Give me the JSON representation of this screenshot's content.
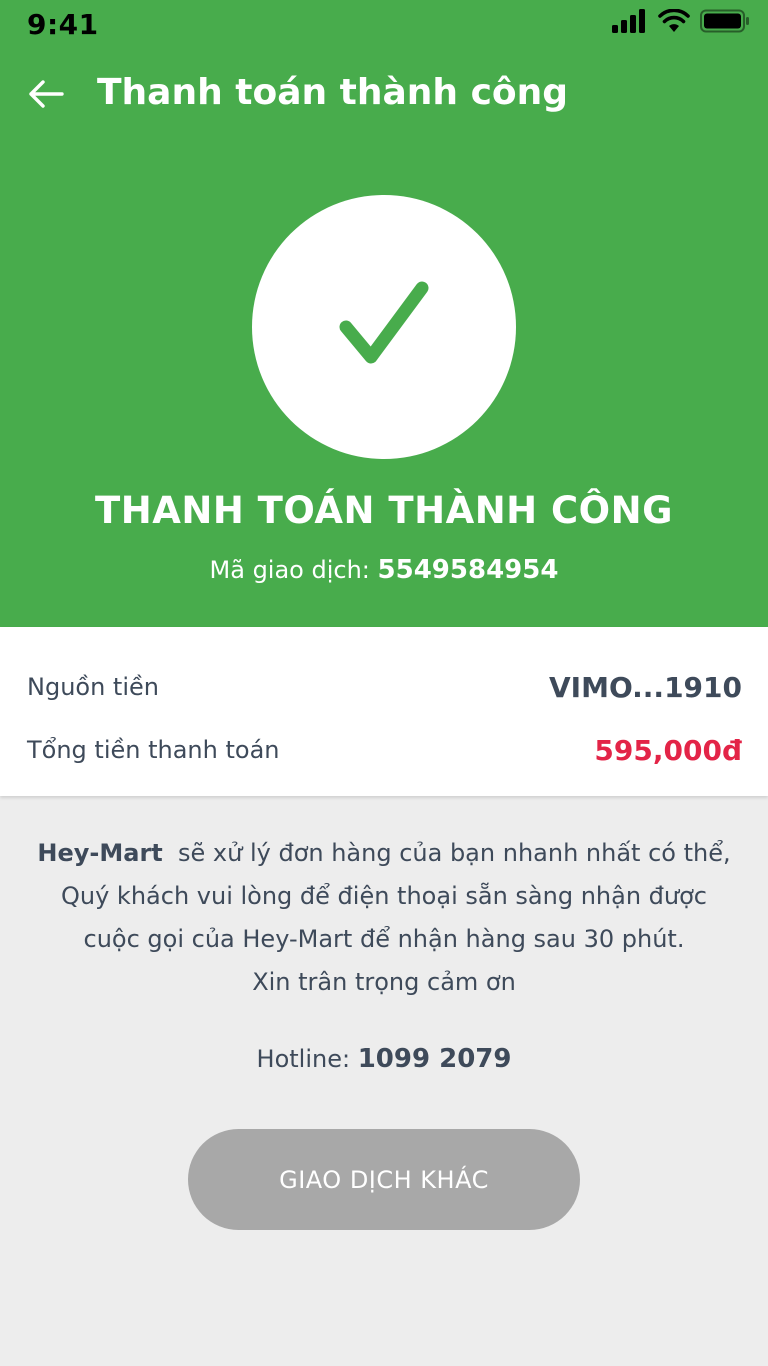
{
  "status_bar": {
    "time": "9:41"
  },
  "header": {
    "title": "Thanh toán thành công"
  },
  "hero": {
    "heading": "THANH TOÁN THÀNH CÔNG",
    "transaction_label": "Mã giao dịch:",
    "transaction_id": "5549584954"
  },
  "summary": {
    "source_label": "Nguồn tiền",
    "source_value": "VIMO...1910",
    "total_label": "Tổng tiền thanh toán",
    "total_value": "595,000đ"
  },
  "message": {
    "brand": "Hey-Mart",
    "line1_rest": "sẽ xử lý đơn hàng của bạn nhanh nhất có thể,",
    "line2": "Quý khách vui lòng để điện thoại sẵn sàng nhận được",
    "line3": "cuộc gọi của Hey-Mart để nhận hàng sau 30 phút.",
    "line4": "Xin trân trọng cảm ơn"
  },
  "hotline": {
    "label": "Hotline:",
    "number": "1099 2079"
  },
  "actions": {
    "other_transaction": "GIAO DỊCH KHÁC"
  },
  "icons": {
    "back": "arrow-left-icon",
    "success": "checkmark-icon",
    "signal": "signal-icon",
    "wifi": "wifi-icon",
    "battery": "battery-icon"
  },
  "colors": {
    "primary_green": "#48ac4c",
    "amount_red": "#e32447",
    "text_dark": "#3e4a5a",
    "button_disabled": "#a8a8a8",
    "background": "#ededed"
  }
}
